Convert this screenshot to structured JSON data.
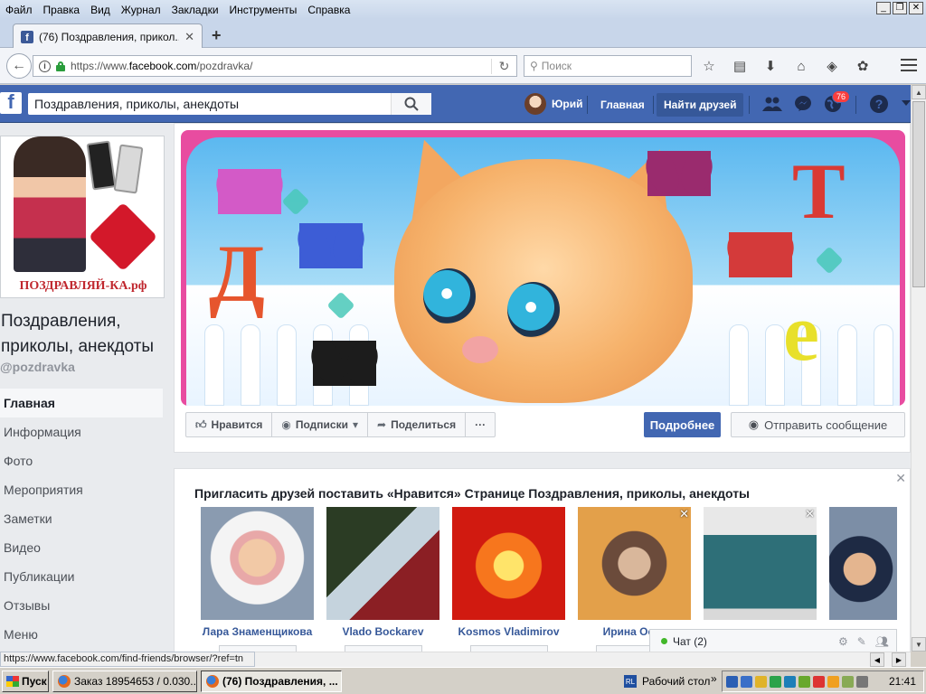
{
  "browser": {
    "menu": [
      "Файл",
      "Правка",
      "Вид",
      "Журнал",
      "Закладки",
      "Инструменты",
      "Справка"
    ],
    "tab_title": "(76) Поздравления, прикол...",
    "url_prefix": "https://www.",
    "url_domain": "facebook.com",
    "url_path": "/pozdravka/",
    "search_placeholder": "Поиск",
    "status_url": "https://www.facebook.com/find-friends/browser/?ref=tn"
  },
  "fb": {
    "search_value": "Поздравления, приколы, анекдоты",
    "user_name": "Юрий",
    "nav_home": "Главная",
    "nav_find_friends": "Найти друзей",
    "notifications_count": "76",
    "help_label": "?"
  },
  "page": {
    "profile_caption": "ПОЗДРАВЛЯЙ-КА.рф",
    "name": "Поздравления, приколы, анекдоты",
    "handle": "@pozdravka",
    "side_nav": [
      "Главная",
      "Информация",
      "Фото",
      "Мероприятия",
      "Заметки",
      "Видео",
      "Публикации",
      "Отзывы",
      "Меню"
    ],
    "cover_letters": [
      "Д",
      "Т",
      "е"
    ],
    "actions": {
      "like": "Нравится",
      "follow": "Подписки",
      "share": "Поделиться",
      "more": "···",
      "learn_more": "Подробнее",
      "send_message": "Отправить сообщение"
    }
  },
  "invite": {
    "title": "Пригласить друзей поставить «Нравится» Странице Поздравления, приколы, анекдоты",
    "friends": [
      {
        "name": "Лара Знаменщикова"
      },
      {
        "name": "Vlado Bockarev"
      },
      {
        "name": "Kosmos Vladimirov"
      },
      {
        "name": "Ирина Остр"
      },
      {
        "name": ""
      },
      {
        "name": ""
      }
    ]
  },
  "chat": {
    "label": "Чат (2)"
  },
  "taskbar": {
    "start": "Пуск",
    "tasks": [
      "Заказ 18954653 / 0.030...",
      "(76) Поздравления, ..."
    ],
    "lang": "RL",
    "desktop": "Рабочий стол",
    "clock": "21:41"
  },
  "colors": {
    "fb_blue": "#4267b2",
    "fb_link": "#365899",
    "badge_red": "#fa3e3e"
  }
}
